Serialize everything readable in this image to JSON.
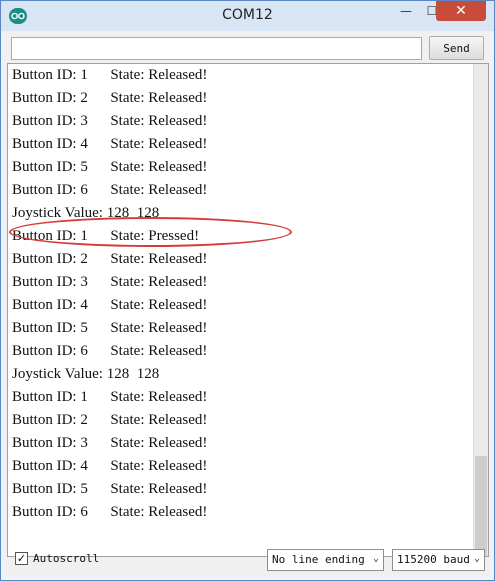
{
  "window": {
    "title": "COM12",
    "minimize_glyph": "—",
    "maximize_glyph": "☐",
    "close_glyph": "✕"
  },
  "toolbar": {
    "send_input_value": "",
    "send_label": "Send"
  },
  "output": {
    "lines": [
      "Button ID: 1      State: Released!",
      "Button ID: 2      State: Released!",
      "Button ID: 3      State: Released!",
      "Button ID: 4      State: Released!",
      "Button ID: 5      State: Released!",
      "Button ID: 6      State: Released!",
      "Joystick Value: 128  128",
      "Button ID: 1      State: Pressed!",
      "Button ID: 2      State: Released!",
      "Button ID: 3      State: Released!",
      "Button ID: 4      State: Released!",
      "Button ID: 5      State: Released!",
      "Button ID: 6      State: Released!",
      "Joystick Value: 128  128",
      "Button ID: 1      State: Released!",
      "Button ID: 2      State: Released!",
      "Button ID: 3      State: Released!",
      "Button ID: 4      State: Released!",
      "Button ID: 5      State: Released!",
      "Button ID: 6      State: Released!"
    ],
    "highlight_color": "#d63b3b"
  },
  "footer": {
    "autoscroll_label": "Autoscroll",
    "autoscroll_checked_glyph": "✓",
    "line_ending_value": "No line ending",
    "baud_rate_value": "115200 baud",
    "dropdown_glyph": "⌄"
  }
}
